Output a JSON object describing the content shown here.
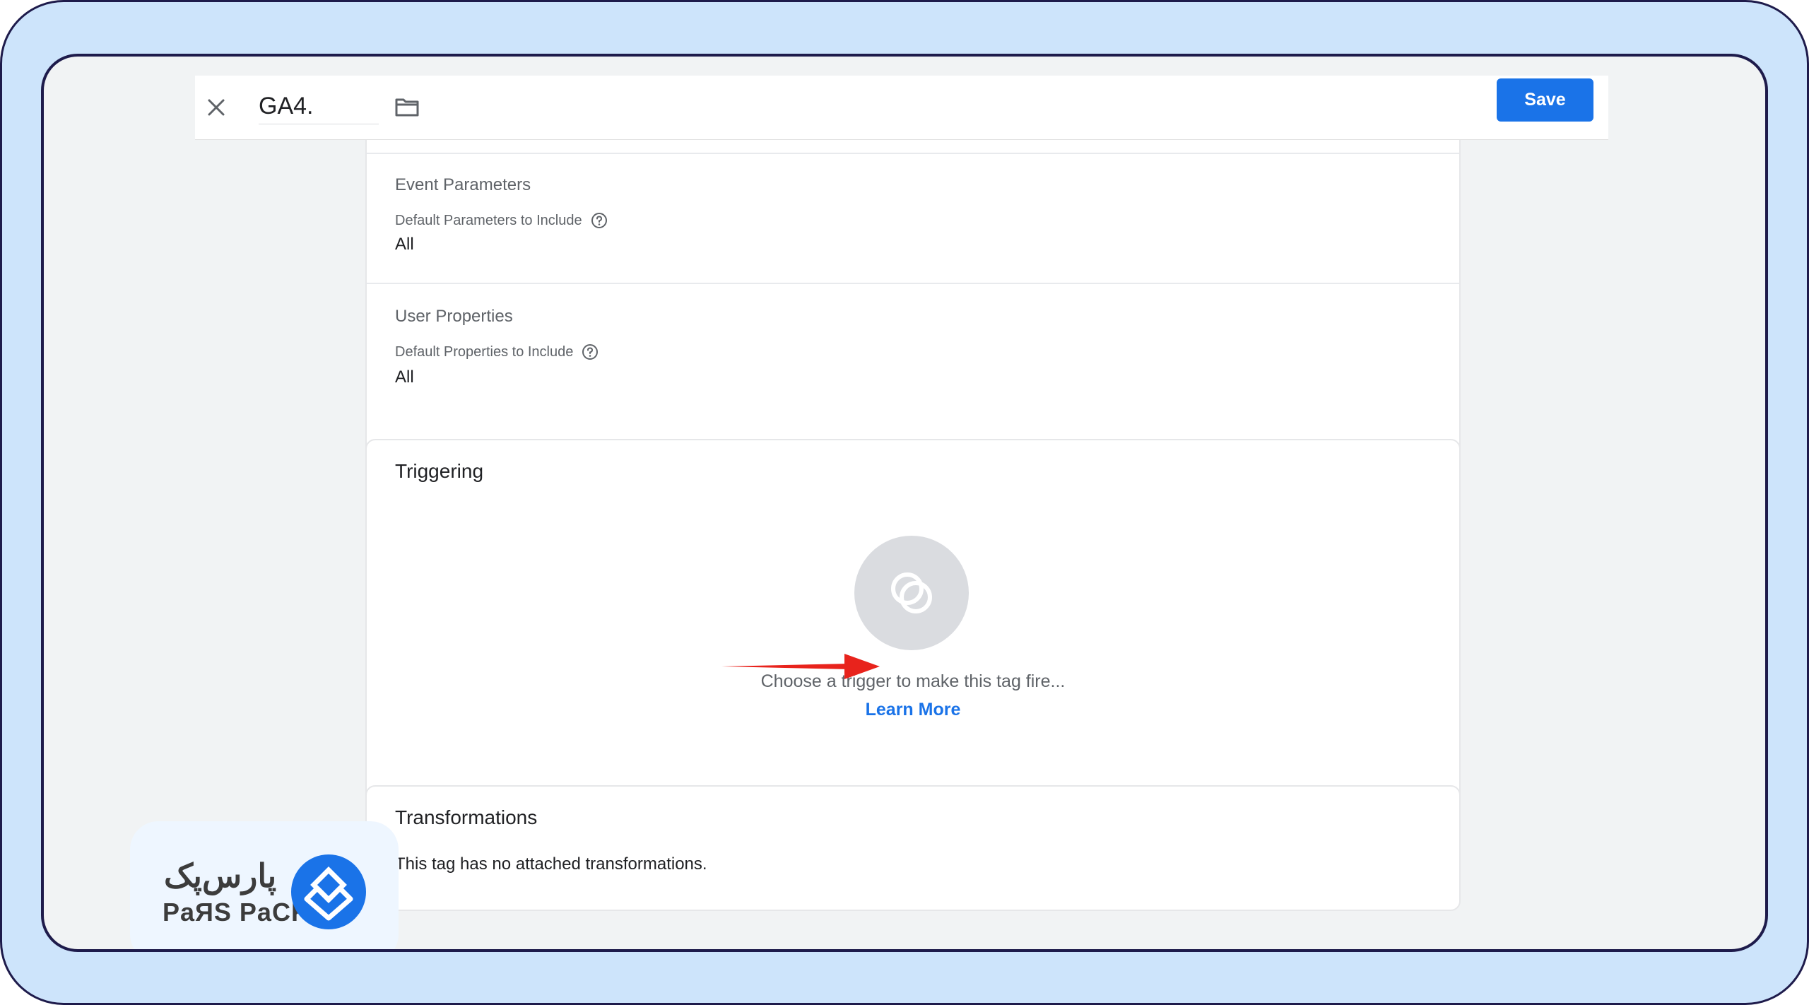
{
  "toolbar": {
    "tag_name": "GA4.",
    "save_label": "Save",
    "close_icon": "close-icon",
    "folder_icon": "folder-icon"
  },
  "event_parameters": {
    "title": "Event Parameters",
    "field_label": "Default Parameters to Include",
    "value": "All"
  },
  "user_properties": {
    "title": "User Properties",
    "field_label": "Default Properties to Include",
    "value": "All"
  },
  "triggering": {
    "title": "Triggering",
    "hint": "Choose a trigger to make this tag fire...",
    "learn_more": "Learn More"
  },
  "transformations": {
    "title": "Transformations",
    "text": "This tag has no attached transformations."
  },
  "logo": {
    "persian": "پارس‌پک",
    "english": "PaЯS PaCK"
  },
  "colors": {
    "accent": "#1a73e8",
    "frame_outer": "#cde4fb",
    "frame_border": "#1e1b4b",
    "annotation_arrow": "#e8231c"
  }
}
